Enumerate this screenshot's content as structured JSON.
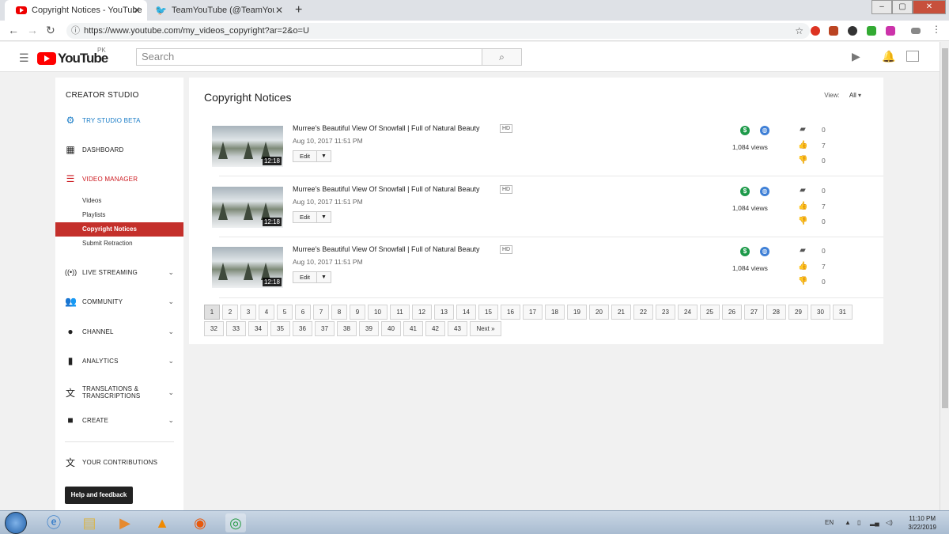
{
  "browser": {
    "tabs": [
      {
        "title": "Copyright Notices - YouTube",
        "icon": "youtube-favicon"
      },
      {
        "title": "TeamYouTube (@TeamYouTube)",
        "icon": "twitter-favicon"
      }
    ],
    "new_tab": "+",
    "url": "https://www.youtube.com/my_videos_copyright?ar=2&o=U",
    "window_controls": [
      "–",
      "▢",
      "✕"
    ]
  },
  "youtube": {
    "logo_text": "YouTube",
    "region": "PK",
    "search_placeholder": "Search"
  },
  "sidebar": {
    "header": "CREATOR STUDIO",
    "items": [
      {
        "label": "TRY STUDIO BETA",
        "icon": "gear-icon",
        "color": "#167ac6"
      },
      {
        "label": "DASHBOARD",
        "icon": "dashboard-icon"
      },
      {
        "label": "VIDEO MANAGER",
        "icon": "video-manager-icon",
        "color": "#cc181e"
      },
      {
        "label": "LIVE STREAMING",
        "icon": "live-icon"
      },
      {
        "label": "COMMUNITY",
        "icon": "community-icon"
      },
      {
        "label": "CHANNEL",
        "icon": "channel-icon"
      },
      {
        "label": "ANALYTICS",
        "icon": "analytics-icon"
      },
      {
        "label": "TRANSLATIONS & TRANSCRIPTIONS",
        "icon": "translate-icon"
      },
      {
        "label": "CREATE",
        "icon": "create-icon"
      },
      {
        "label": "YOUR CONTRIBUTIONS",
        "icon": "contributions-icon"
      }
    ],
    "subitems": [
      {
        "label": "Videos"
      },
      {
        "label": "Playlists"
      },
      {
        "label": "Copyright Notices",
        "selected": true
      },
      {
        "label": "Submit Retraction"
      }
    ],
    "help": "Help and feedback"
  },
  "main": {
    "title": "Copyright Notices",
    "view_label": "View:",
    "view_value": "All",
    "videos": [
      {
        "title": "Murree's Beautiful View Of Snowfall | Full of Natural Beauty",
        "badge": "HD",
        "date": "Aug 10, 2017 11:51 PM",
        "duration": "12:18",
        "edit": "Edit",
        "views": "1,084 views",
        "comments": "0",
        "likes": "7",
        "dislikes": "0"
      },
      {
        "title": "Murree's Beautiful View Of Snowfall | Full of Natural Beauty",
        "badge": "HD",
        "date": "Aug 10, 2017 11:51 PM",
        "duration": "12:18",
        "edit": "Edit",
        "views": "1,084 views",
        "comments": "0",
        "likes": "7",
        "dislikes": "0"
      },
      {
        "title": "Murree's Beautiful View Of Snowfall | Full of Natural Beauty",
        "badge": "HD",
        "date": "Aug 10, 2017 11:51 PM",
        "duration": "12:18",
        "edit": "Edit",
        "views": "1,084 views",
        "comments": "0",
        "likes": "7",
        "dislikes": "0"
      }
    ],
    "pages": [
      "1",
      "2",
      "3",
      "4",
      "5",
      "6",
      "7",
      "8",
      "9",
      "10",
      "11",
      "12",
      "13",
      "14",
      "15",
      "16",
      "17",
      "18",
      "19",
      "20",
      "21",
      "22",
      "23",
      "24",
      "25",
      "26",
      "27",
      "28",
      "29",
      "30",
      "31",
      "32",
      "33",
      "34",
      "35",
      "36",
      "37",
      "38",
      "39",
      "40",
      "41",
      "42",
      "43",
      "Next »"
    ],
    "current_page": "1"
  },
  "taskbar": {
    "lang": "EN",
    "time": "11:10 PM",
    "date": "3/22/2019"
  }
}
